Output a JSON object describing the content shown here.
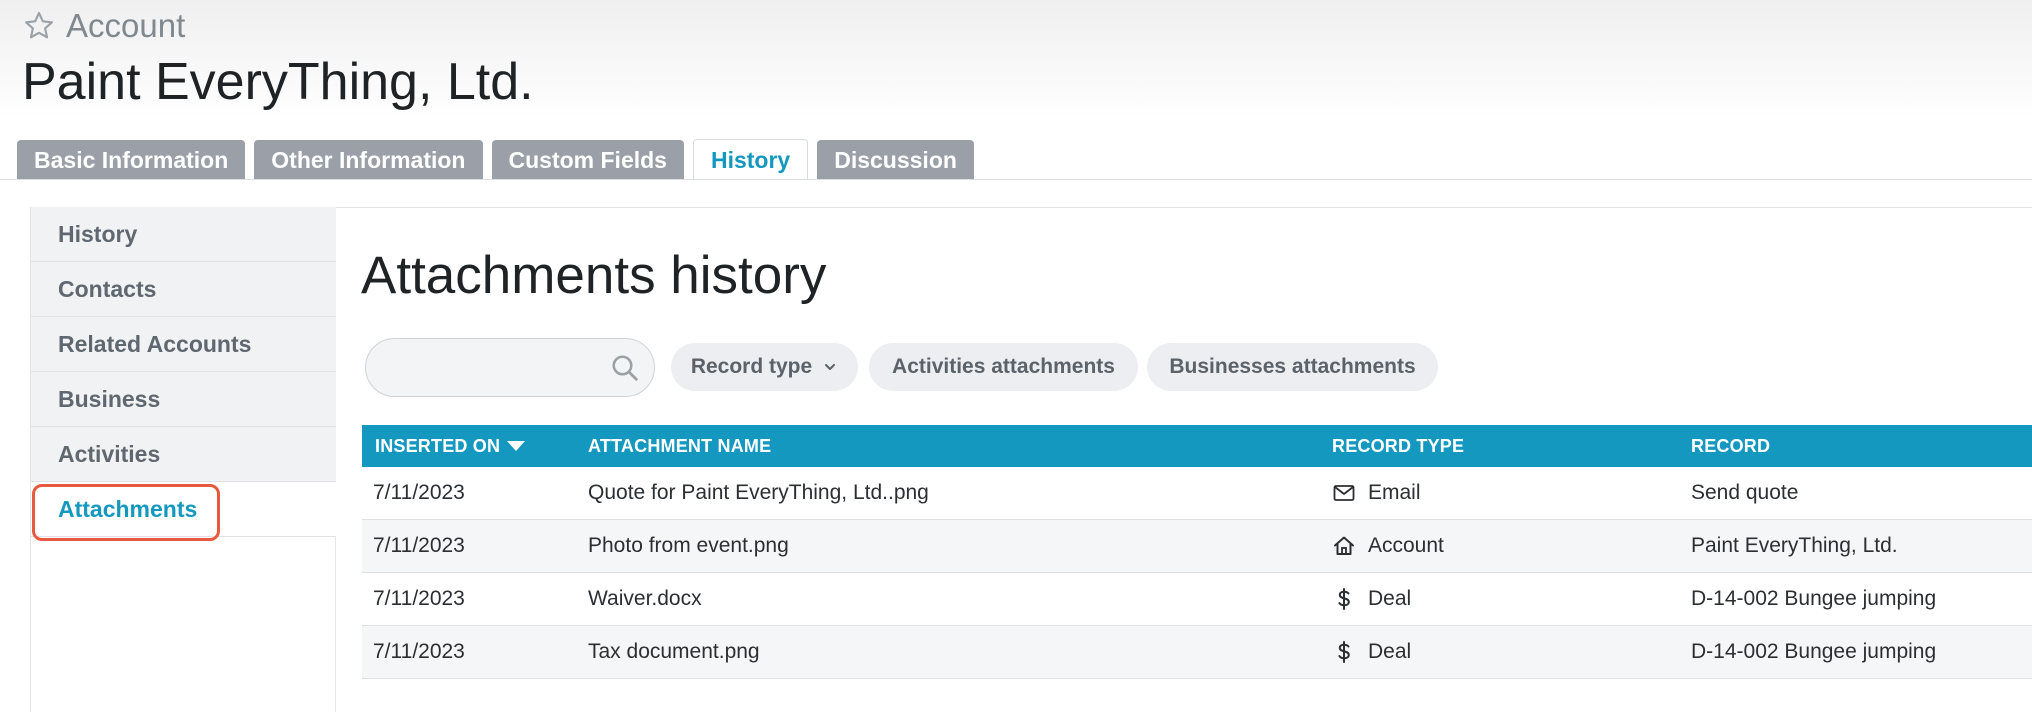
{
  "breadcrumb": {
    "label": "Account"
  },
  "page_title": "Paint EveryThing, Ltd.",
  "tabs": [
    {
      "label": "Basic Information",
      "active": false
    },
    {
      "label": "Other Information",
      "active": false
    },
    {
      "label": "Custom Fields",
      "active": false
    },
    {
      "label": "History",
      "active": true
    },
    {
      "label": "Discussion",
      "active": false
    }
  ],
  "sidebar": {
    "items": [
      {
        "label": "History",
        "active": false
      },
      {
        "label": "Contacts",
        "active": false
      },
      {
        "label": "Related Accounts",
        "active": false
      },
      {
        "label": "Business",
        "active": false
      },
      {
        "label": "Activities",
        "active": false
      },
      {
        "label": "Attachments",
        "active": true
      }
    ]
  },
  "main": {
    "title": "Attachments history",
    "search": {
      "value": "",
      "placeholder": "",
      "icon": "search-icon"
    },
    "filters": {
      "record_type": "Record type",
      "activities": "Activities attachments",
      "businesses": "Businesses attachments"
    }
  },
  "table": {
    "columns": [
      "INSERTED ON",
      "ATTACHMENT NAME",
      "RECORD TYPE",
      "RECORD"
    ],
    "rows": [
      {
        "inserted_on": "7/11/2023",
        "name": "Quote for Paint EveryThing, Ltd..png",
        "record_type": "Email",
        "record_icon": "envelope-icon",
        "record": "Send quote"
      },
      {
        "inserted_on": "7/11/2023",
        "name": "Photo from event.png",
        "record_type": "Account",
        "record_icon": "home-icon",
        "record": "Paint EveryThing, Ltd."
      },
      {
        "inserted_on": "7/11/2023",
        "name": "Waiver.docx",
        "record_type": "Deal",
        "record_icon": "dollar-icon",
        "record": "D-14-002 Bungee jumping"
      },
      {
        "inserted_on": "7/11/2023",
        "name": "Tax document.png",
        "record_type": "Deal",
        "record_icon": "dollar-icon",
        "record": "D-14-002 Bungee jumping"
      }
    ]
  },
  "colors": {
    "accent": "#1498bd",
    "header_bg": "#1598bf",
    "tab_inactive": "#9ba0a8",
    "highlight": "#e8593d"
  }
}
